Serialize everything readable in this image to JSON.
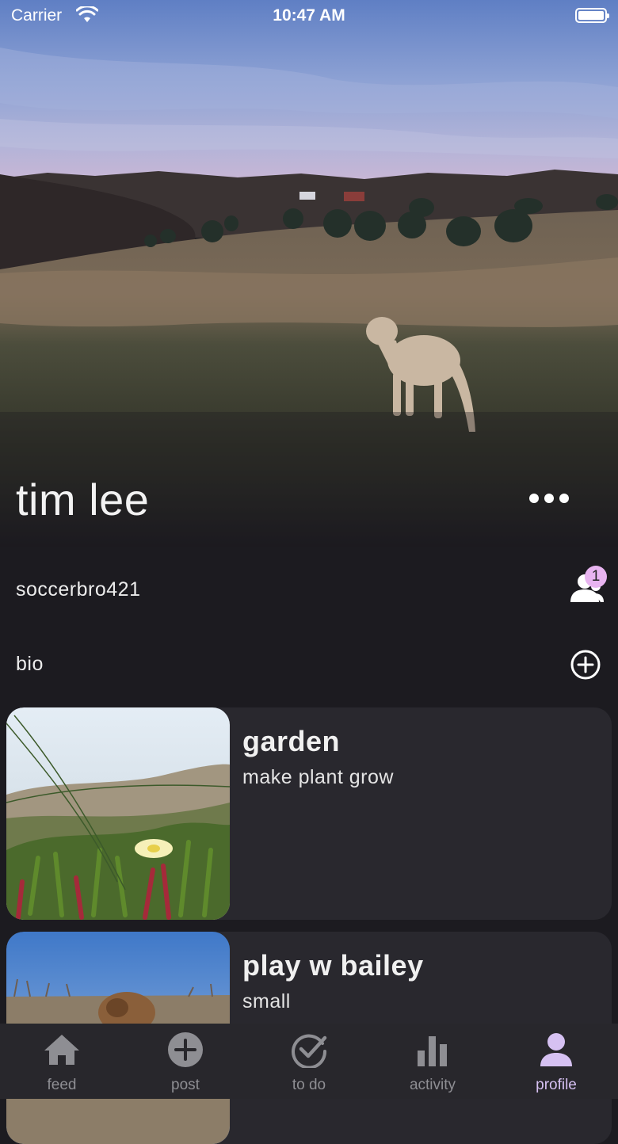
{
  "status_bar": {
    "carrier": "Carrier",
    "time": "10:47 AM"
  },
  "profile": {
    "name": "tim lee",
    "username": "soccerbro421",
    "friend_request_count": "1",
    "bio_label": "bio"
  },
  "projects": [
    {
      "title": "garden",
      "subtitle": "make plant grow"
    },
    {
      "title": "play w bailey",
      "subtitle": "small"
    }
  ],
  "tabs": [
    {
      "label": "feed",
      "icon": "home-icon"
    },
    {
      "label": "post",
      "icon": "plus-circle-icon"
    },
    {
      "label": "to do",
      "icon": "check-circle-icon"
    },
    {
      "label": "activity",
      "icon": "bar-chart-icon"
    },
    {
      "label": "profile",
      "icon": "person-icon",
      "active": true
    }
  ],
  "colors": {
    "accent": "#d6c1f2",
    "badge": "#e8b4f0",
    "background": "#1c1b20",
    "card": "#29282e",
    "tab_bar": "#28272c"
  }
}
